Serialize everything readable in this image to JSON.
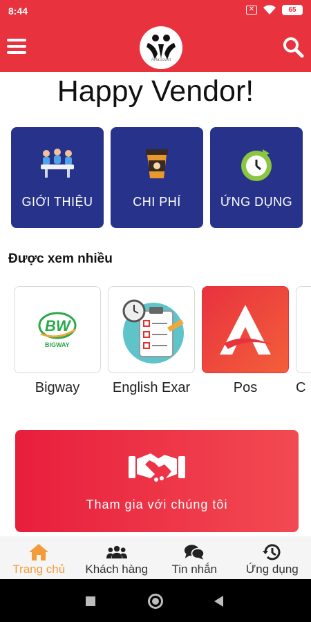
{
  "status_bar": {
    "time": "8:44",
    "battery": "65",
    "sim_icon": "x-mark-icon",
    "wifi_icon": "wifi-icon"
  },
  "header": {
    "menu_icon": "hamburger-menu-icon",
    "logo_caption": "AHaSoviet",
    "search_icon": "search-icon",
    "background": "#e8333f"
  },
  "page_title": "Happy Vendor!",
  "categories": [
    {
      "label": "GIỚI THIỆU",
      "icon": "meeting-table-icon"
    },
    {
      "label": "CHI PHÍ",
      "icon": "coffee-cup-icon"
    },
    {
      "label": "ỨNG DỤNG",
      "icon": "clock-refresh-icon"
    }
  ],
  "popular": {
    "title": "Được xem nhiều",
    "items": [
      {
        "name": "Bigway",
        "icon": "bigway-logo"
      },
      {
        "name": "English Exar",
        "icon": "checklist-timer-icon"
      },
      {
        "name": "Pos",
        "icon": "pos-logo"
      },
      {
        "name": "C",
        "icon": "partial-app-logo"
      }
    ]
  },
  "banner": {
    "label": "Tham gia với chúng tôi",
    "icon": "handshake-icon"
  },
  "bottom_nav": {
    "active_color": "#f39a39",
    "items": [
      {
        "label": "Trang chủ",
        "icon": "home-icon"
      },
      {
        "label": "Khách hàng",
        "icon": "users-icon"
      },
      {
        "label": "Tin nhắn",
        "icon": "chat-icon"
      },
      {
        "label": "Ứng dụng",
        "icon": "history-icon"
      }
    ]
  },
  "colors": {
    "primary_red": "#e8333f",
    "tile_blue": "#27338a",
    "banner_red": "#e81e3c"
  }
}
